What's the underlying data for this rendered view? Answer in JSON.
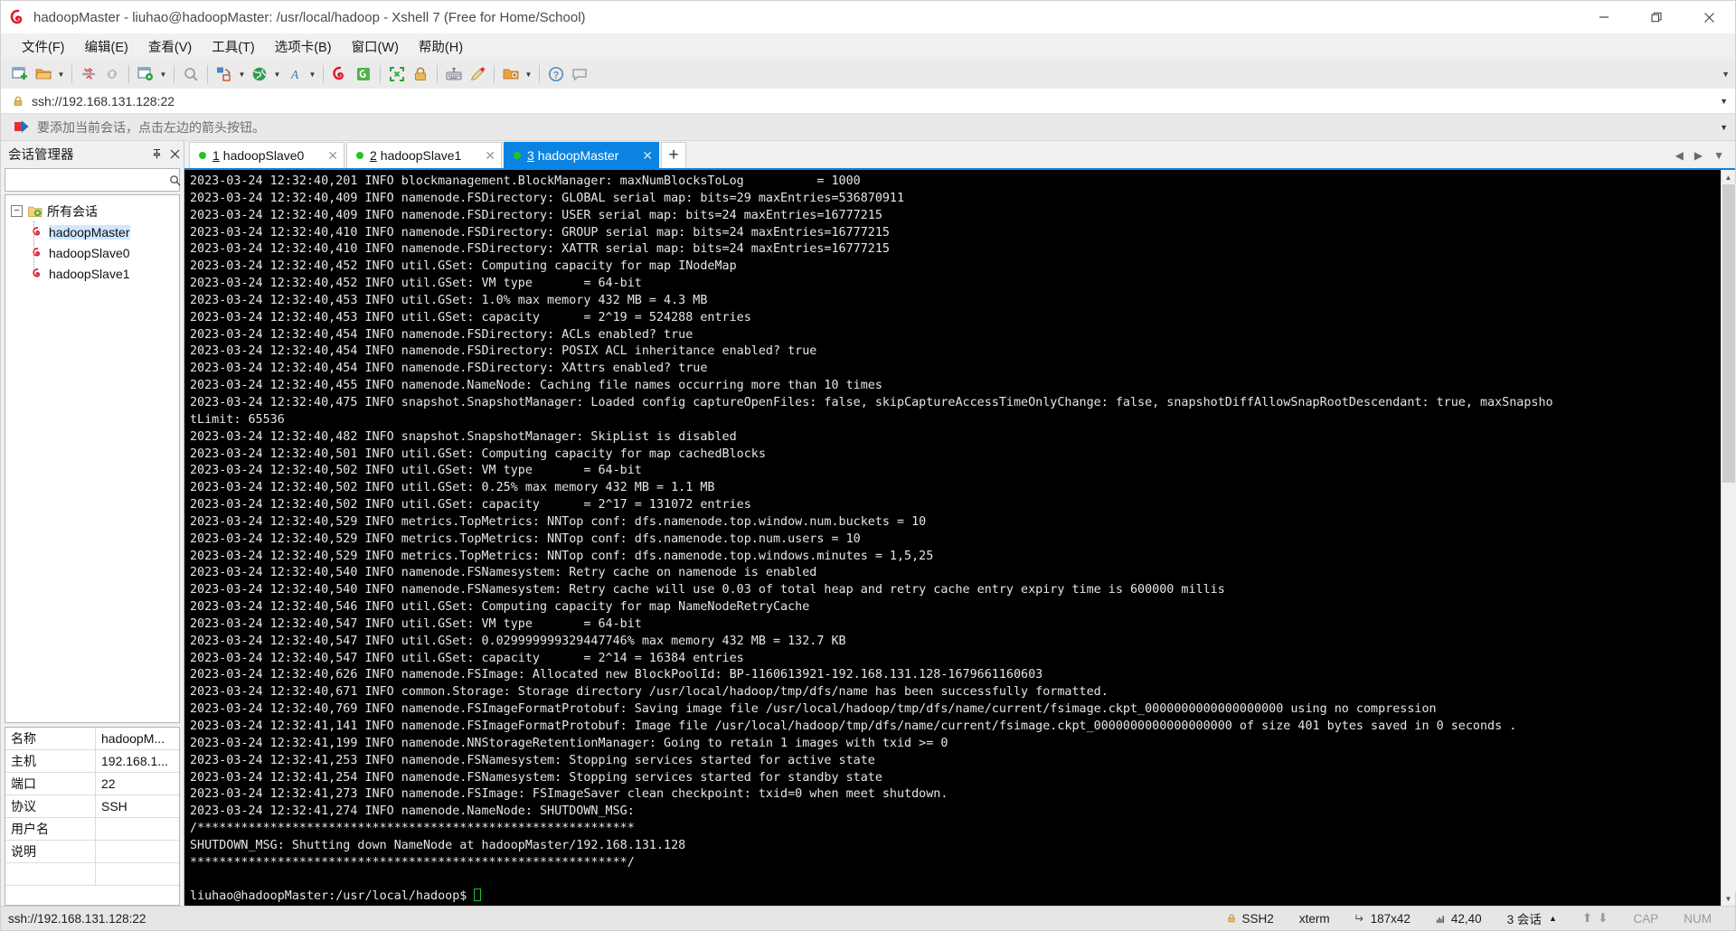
{
  "window": {
    "title": "hadoopMaster - liuhao@hadoopMaster: /usr/local/hadoop - Xshell 7 (Free for Home/School)",
    "minimize_label": "—",
    "maximize_label": "❐",
    "close_label": "✕"
  },
  "menubar": {
    "items": [
      {
        "label": "文件(F)"
      },
      {
        "label": "编辑(E)"
      },
      {
        "label": "查看(V)"
      },
      {
        "label": "工具(T)"
      },
      {
        "label": "选项卡(B)"
      },
      {
        "label": "窗口(W)"
      },
      {
        "label": "帮助(H)"
      }
    ]
  },
  "toolbar": {
    "buttons": [
      {
        "name": "new-session-icon",
        "has_arrow": false
      },
      {
        "name": "open-folder-icon",
        "has_arrow": true
      },
      {
        "name": "disconnect-icon",
        "has_arrow": false
      },
      {
        "name": "reconnect-icon",
        "has_arrow": false
      },
      {
        "name": "session-properties-icon",
        "has_arrow": true
      },
      {
        "name": "find-icon",
        "has_arrow": false
      },
      {
        "name": "transfer-file-icon",
        "has_arrow": true
      },
      {
        "name": "globe-icon",
        "has_arrow": true
      },
      {
        "name": "font-icon",
        "has_arrow": true
      },
      {
        "name": "xshell-icon",
        "has_arrow": false
      },
      {
        "name": "xftp-icon",
        "has_arrow": false
      },
      {
        "name": "fullscreen-icon",
        "has_arrow": false
      },
      {
        "name": "lock-icon",
        "has_arrow": false
      },
      {
        "name": "keyboard-icon",
        "has_arrow": false
      },
      {
        "name": "highlight-icon",
        "has_arrow": false
      },
      {
        "name": "add-folder-icon",
        "has_arrow": true
      },
      {
        "name": "help-icon",
        "has_arrow": false
      },
      {
        "name": "chat-icon",
        "has_arrow": false
      }
    ]
  },
  "address_bar": {
    "value": "ssh://192.168.131.128:22",
    "lock_icon": "lock-icon",
    "caret_icon": "chevron-down-icon"
  },
  "info_bar": {
    "message": "要添加当前会话，点击左边的箭头按钮。",
    "icon": "red-arrow-icon",
    "caret_icon": "chevron-down-icon"
  },
  "sidebar": {
    "title": "会话管理器",
    "pin_label": "中",
    "close_label": "✕",
    "search_placeholder": "",
    "search_value": "",
    "tree": {
      "root": {
        "label": "所有会话",
        "expander": "−",
        "icon": "folder-icon"
      },
      "children": [
        {
          "label": "hadoopMaster",
          "icon": "xshell-session-icon",
          "selected": true
        },
        {
          "label": "hadoopSlave0",
          "icon": "xshell-session-icon",
          "selected": false
        },
        {
          "label": "hadoopSlave1",
          "icon": "xshell-session-icon",
          "selected": false
        }
      ]
    },
    "properties": [
      {
        "key": "名称",
        "value": "hadoopM..."
      },
      {
        "key": "主机",
        "value": "192.168.1..."
      },
      {
        "key": "端口",
        "value": "22"
      },
      {
        "key": "协议",
        "value": "SSH"
      },
      {
        "key": "用户名",
        "value": ""
      },
      {
        "key": "说明",
        "value": ""
      },
      {
        "key": "",
        "value": ""
      }
    ]
  },
  "tabs": {
    "items": [
      {
        "num": "1",
        "label": "hadoopSlave0",
        "active": false,
        "close_label": "✕",
        "status": "connected"
      },
      {
        "num": "2",
        "label": "hadoopSlave1",
        "active": false,
        "close_label": "✕",
        "status": "connected"
      },
      {
        "num": "3",
        "label": "hadoopMaster",
        "active": true,
        "close_label": "✕",
        "status": "connected"
      }
    ],
    "add_label": "+",
    "nav_prev": "◀",
    "nav_next": "▶",
    "nav_menu": "▼"
  },
  "terminal": {
    "lines": [
      "2023-03-24 12:32:40,201 INFO blockmanagement.BlockManager: maxNumBlocksToLog          = 1000",
      "2023-03-24 12:32:40,409 INFO namenode.FSDirectory: GLOBAL serial map: bits=29 maxEntries=536870911",
      "2023-03-24 12:32:40,409 INFO namenode.FSDirectory: USER serial map: bits=24 maxEntries=16777215",
      "2023-03-24 12:32:40,410 INFO namenode.FSDirectory: GROUP serial map: bits=24 maxEntries=16777215",
      "2023-03-24 12:32:40,410 INFO namenode.FSDirectory: XATTR serial map: bits=24 maxEntries=16777215",
      "2023-03-24 12:32:40,452 INFO util.GSet: Computing capacity for map INodeMap",
      "2023-03-24 12:32:40,452 INFO util.GSet: VM type       = 64-bit",
      "2023-03-24 12:32:40,453 INFO util.GSet: 1.0% max memory 432 MB = 4.3 MB",
      "2023-03-24 12:32:40,453 INFO util.GSet: capacity      = 2^19 = 524288 entries",
      "2023-03-24 12:32:40,454 INFO namenode.FSDirectory: ACLs enabled? true",
      "2023-03-24 12:32:40,454 INFO namenode.FSDirectory: POSIX ACL inheritance enabled? true",
      "2023-03-24 12:32:40,454 INFO namenode.FSDirectory: XAttrs enabled? true",
      "2023-03-24 12:32:40,455 INFO namenode.NameNode: Caching file names occurring more than 10 times",
      "2023-03-24 12:32:40,475 INFO snapshot.SnapshotManager: Loaded config captureOpenFiles: false, skipCaptureAccessTimeOnlyChange: false, snapshotDiffAllowSnapRootDescendant: true, maxSnapsho",
      "tLimit: 65536",
      "2023-03-24 12:32:40,482 INFO snapshot.SnapshotManager: SkipList is disabled",
      "2023-03-24 12:32:40,501 INFO util.GSet: Computing capacity for map cachedBlocks",
      "2023-03-24 12:32:40,502 INFO util.GSet: VM type       = 64-bit",
      "2023-03-24 12:32:40,502 INFO util.GSet: 0.25% max memory 432 MB = 1.1 MB",
      "2023-03-24 12:32:40,502 INFO util.GSet: capacity      = 2^17 = 131072 entries",
      "2023-03-24 12:32:40,529 INFO metrics.TopMetrics: NNTop conf: dfs.namenode.top.window.num.buckets = 10",
      "2023-03-24 12:32:40,529 INFO metrics.TopMetrics: NNTop conf: dfs.namenode.top.num.users = 10",
      "2023-03-24 12:32:40,529 INFO metrics.TopMetrics: NNTop conf: dfs.namenode.top.windows.minutes = 1,5,25",
      "2023-03-24 12:32:40,540 INFO namenode.FSNamesystem: Retry cache on namenode is enabled",
      "2023-03-24 12:32:40,540 INFO namenode.FSNamesystem: Retry cache will use 0.03 of total heap and retry cache entry expiry time is 600000 millis",
      "2023-03-24 12:32:40,546 INFO util.GSet: Computing capacity for map NameNodeRetryCache",
      "2023-03-24 12:32:40,547 INFO util.GSet: VM type       = 64-bit",
      "2023-03-24 12:32:40,547 INFO util.GSet: 0.029999999329447746% max memory 432 MB = 132.7 KB",
      "2023-03-24 12:32:40,547 INFO util.GSet: capacity      = 2^14 = 16384 entries",
      "2023-03-24 12:32:40,626 INFO namenode.FSImage: Allocated new BlockPoolId: BP-1160613921-192.168.131.128-1679661160603",
      "2023-03-24 12:32:40,671 INFO common.Storage: Storage directory /usr/local/hadoop/tmp/dfs/name has been successfully formatted.",
      "2023-03-24 12:32:40,769 INFO namenode.FSImageFormatProtobuf: Saving image file /usr/local/hadoop/tmp/dfs/name/current/fsimage.ckpt_0000000000000000000 using no compression",
      "2023-03-24 12:32:41,141 INFO namenode.FSImageFormatProtobuf: Image file /usr/local/hadoop/tmp/dfs/name/current/fsimage.ckpt_0000000000000000000 of size 401 bytes saved in 0 seconds .",
      "2023-03-24 12:32:41,199 INFO namenode.NNStorageRetentionManager: Going to retain 1 images with txid >= 0",
      "2023-03-24 12:32:41,253 INFO namenode.FSNamesystem: Stopping services started for active state",
      "2023-03-24 12:32:41,254 INFO namenode.FSNamesystem: Stopping services started for standby state",
      "2023-03-24 12:32:41,273 INFO namenode.FSImage: FSImageSaver clean checkpoint: txid=0 when meet shutdown.",
      "2023-03-24 12:32:41,274 INFO namenode.NameNode: SHUTDOWN_MSG:",
      "/************************************************************",
      "SHUTDOWN_MSG: Shutting down NameNode at hadoopMaster/192.168.131.128",
      "************************************************************/",
      ""
    ],
    "prompt": "liuhao@hadoopMaster:/usr/local/hadoop$ ",
    "cursor_color": "#21c521",
    "bg_color": "#000000",
    "fg_color": "#e6e6e6"
  },
  "statusbar": {
    "left": "ssh://192.168.131.128:22",
    "protocol": "SSH2",
    "term_type": "xterm",
    "size": "187x42",
    "cursor_pos": "42,40",
    "sessions": "3 会话",
    "sessions_caret": "▲",
    "upload_icon": "⬆",
    "download_icon": "⬇",
    "cap": "CAP",
    "num": "NUM"
  }
}
